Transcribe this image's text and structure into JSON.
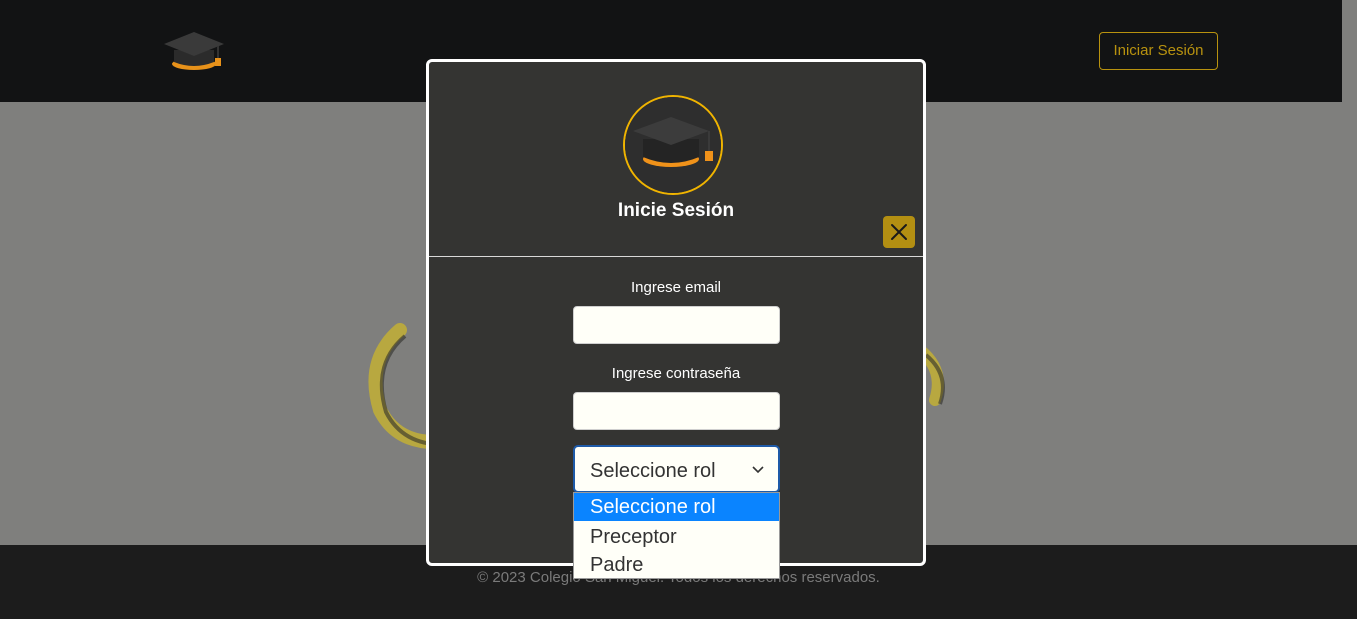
{
  "navbar": {
    "login_label": "Iniciar Sesión"
  },
  "modal": {
    "title": "Inicie Sesión",
    "email_label": "Ingrese email",
    "email_value": "",
    "password_label": "Ingrese contraseña",
    "password_value": "",
    "role_select": {
      "selected": "Seleccione rol",
      "options": [
        "Seleccione rol",
        "Preceptor",
        "Padre"
      ]
    }
  },
  "footer": {
    "text": "© 2023 Colegio San Miguel. Todos los derechos reservados."
  },
  "colors": {
    "navbar_bg": "#121314",
    "accent_gold": "#b8920f",
    "modal_bg": "#343432",
    "highlight_blue": "#0a84ff"
  },
  "icons": [
    "graduation-cap-icon",
    "close-icon",
    "chevron-down-icon"
  ]
}
